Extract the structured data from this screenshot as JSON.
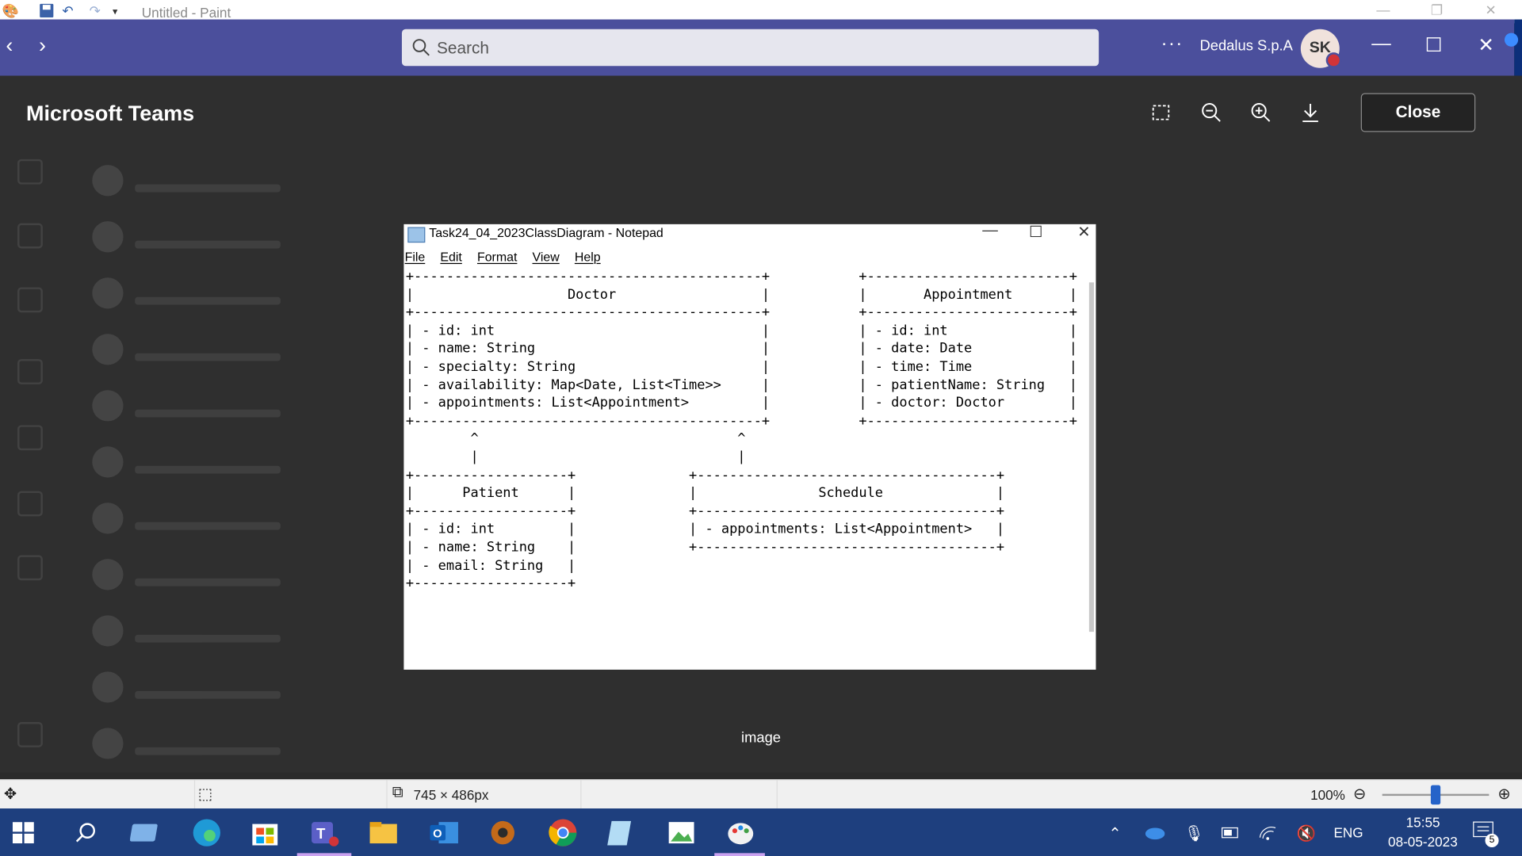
{
  "paint": {
    "title": "Untitled - Paint",
    "status": {
      "dimensions": "745 × 486px",
      "zoom": "100%"
    }
  },
  "teams": {
    "search_placeholder": "Search",
    "more_label": "···",
    "org_name": "Dedalus S.p.A",
    "avatar_initials": "SK"
  },
  "viewer": {
    "title": "Microsoft Teams",
    "close_label": "Close",
    "caption": "image"
  },
  "notepad": {
    "title": "Task24_04_2023ClassDiagram - Notepad",
    "menu": [
      "File",
      "Edit",
      "Format",
      "View",
      "Help"
    ],
    "content": "+-------------------------------------------+           +-------------------------+\n|                   Doctor                  |           |       Appointment       |\n+-------------------------------------------+           +-------------------------+\n| - id: int                                 |           | - id: int               |\n| - name: String                            |           | - date: Date            |\n| - specialty: String                       |           | - time: Time            |\n| - availability: Map<Date, List<Time>>     |           | - patientName: String   |\n| - appointments: List<Appointment>         |           | - doctor: Doctor        |\n+-------------------------------------------+           +-------------------------+\n        ^                                ^\n        |                                |\n+-------------------+              +-------------------------------------+\n|      Patient      |              |               Schedule              |\n+-------------------+              +-------------------------------------+\n| - id: int         |              | - appointments: List<Appointment>   |\n| - name: String    |              +-------------------------------------+\n| - email: String   |\n+-------------------+"
  },
  "taskbar": {
    "language": "ENG",
    "time": "15:55",
    "date": "08-05-2023",
    "notification_count": "5"
  },
  "colors": {
    "teams_header": "#4b4f9c",
    "taskbar": "#1e3f7e",
    "zoom_thumb": "#2563c9"
  }
}
